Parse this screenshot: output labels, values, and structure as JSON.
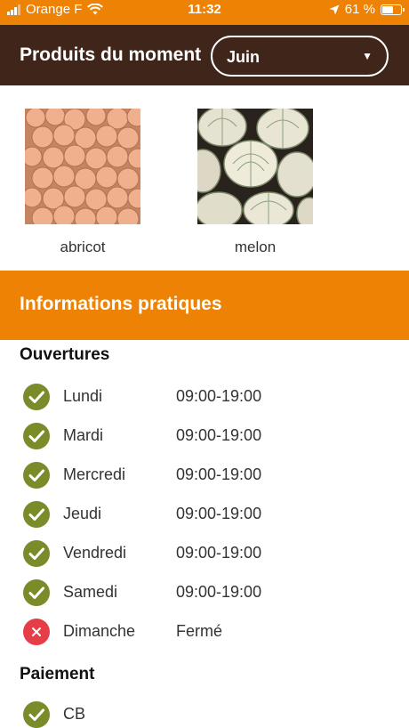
{
  "status_bar": {
    "carrier": "Orange F",
    "time": "11:32",
    "battery": "61 %"
  },
  "header": {
    "title": "Produits du moment",
    "month_select": {
      "value": "Juin"
    }
  },
  "products": [
    {
      "name": "abricot"
    },
    {
      "name": "melon"
    }
  ],
  "info": {
    "title": "Informations pratiques",
    "openings_title": "Ouvertures",
    "openings": [
      {
        "day": "Lundi",
        "hours": "09:00-19:00",
        "open": true
      },
      {
        "day": "Mardi",
        "hours": "09:00-19:00",
        "open": true
      },
      {
        "day": "Mercredi",
        "hours": "09:00-19:00",
        "open": true
      },
      {
        "day": "Jeudi",
        "hours": "09:00-19:00",
        "open": true
      },
      {
        "day": "Vendredi",
        "hours": "09:00-19:00",
        "open": true
      },
      {
        "day": "Samedi",
        "hours": "09:00-19:00",
        "open": true
      },
      {
        "day": "Dimanche",
        "hours": "Fermé",
        "open": false
      }
    ],
    "payment_title": "Paiement",
    "payments": [
      {
        "label": "CB",
        "accepted": true
      }
    ]
  },
  "colors": {
    "accent": "#ee8205",
    "header_bg": "#40261a",
    "check": "#7a8c2a",
    "closed": "#e53e48"
  },
  "icons": {
    "open": "check-circle-icon",
    "closed": "close-circle-icon"
  }
}
